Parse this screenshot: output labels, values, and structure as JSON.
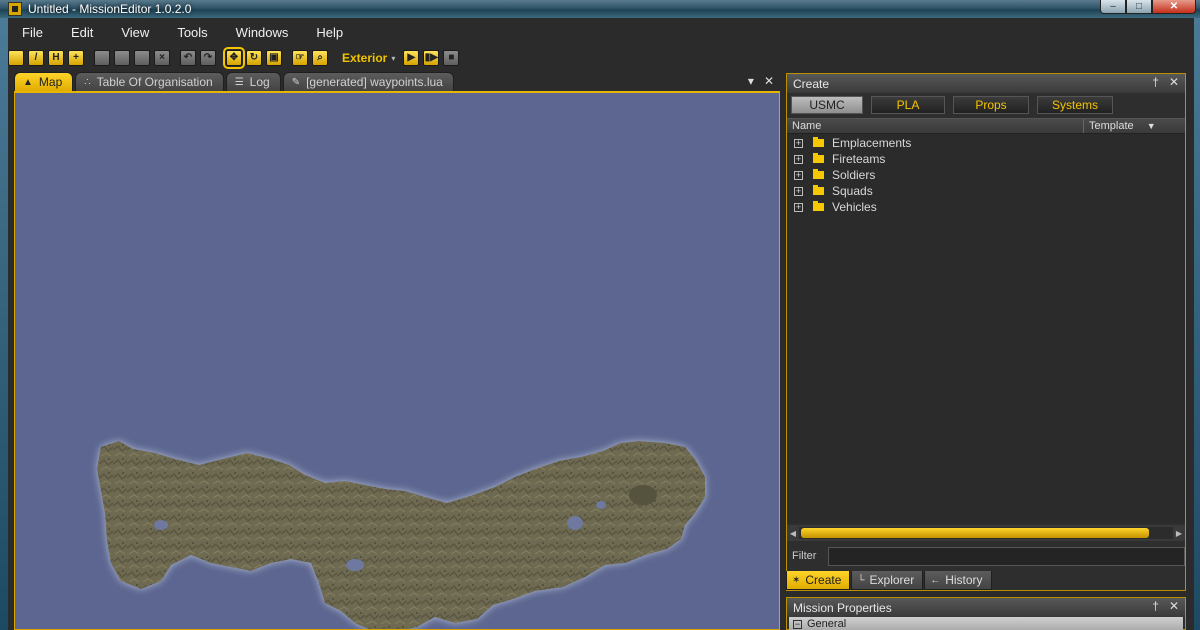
{
  "window": {
    "title": "Untitled - MissionEditor 1.0.2.0",
    "min_glyph": "–",
    "max_glyph": "□",
    "close_glyph": "✕"
  },
  "menu": [
    "File",
    "Edit",
    "View",
    "Tools",
    "Windows",
    "Help"
  ],
  "toolbar": {
    "mode_label": "Exterior",
    "mode_caret": "▾"
  },
  "doc_tabs": [
    {
      "label": "Map",
      "icon": "▲"
    },
    {
      "label": "Table Of Organisation",
      "icon": "∴"
    },
    {
      "label": "Log",
      "icon": "☰"
    },
    {
      "label": "[generated] waypoints.lua",
      "icon": "✎"
    }
  ],
  "tab_controls": {
    "dropdown": "▾",
    "close": "✕"
  },
  "create_panel": {
    "title": "Create",
    "pin": "†",
    "close": "✕",
    "factions": [
      "USMC",
      "PLA",
      "Props",
      "Systems"
    ],
    "columns": {
      "name": "Name",
      "template": "Template",
      "template_caret": "▼"
    },
    "tree_items": [
      "Emplacements",
      "Fireteams",
      "Soldiers",
      "Squads",
      "Vehicles"
    ],
    "expander_glyph": "+",
    "filter_label": "Filter",
    "filter_value": "",
    "scroll_left": "◀",
    "scroll_right": "▶"
  },
  "bottom_tabs": [
    {
      "label": "Create",
      "icon": "✶"
    },
    {
      "label": "Explorer",
      "icon": "└"
    },
    {
      "label": "History",
      "icon": "←"
    }
  ],
  "mission_panel": {
    "title": "Mission Properties",
    "pin": "†",
    "close": "✕",
    "section": "General",
    "section_glyph": "−"
  },
  "colors": {
    "accent": "#f4c400",
    "map_water": "#5c6690",
    "land": "#6e6a52"
  }
}
